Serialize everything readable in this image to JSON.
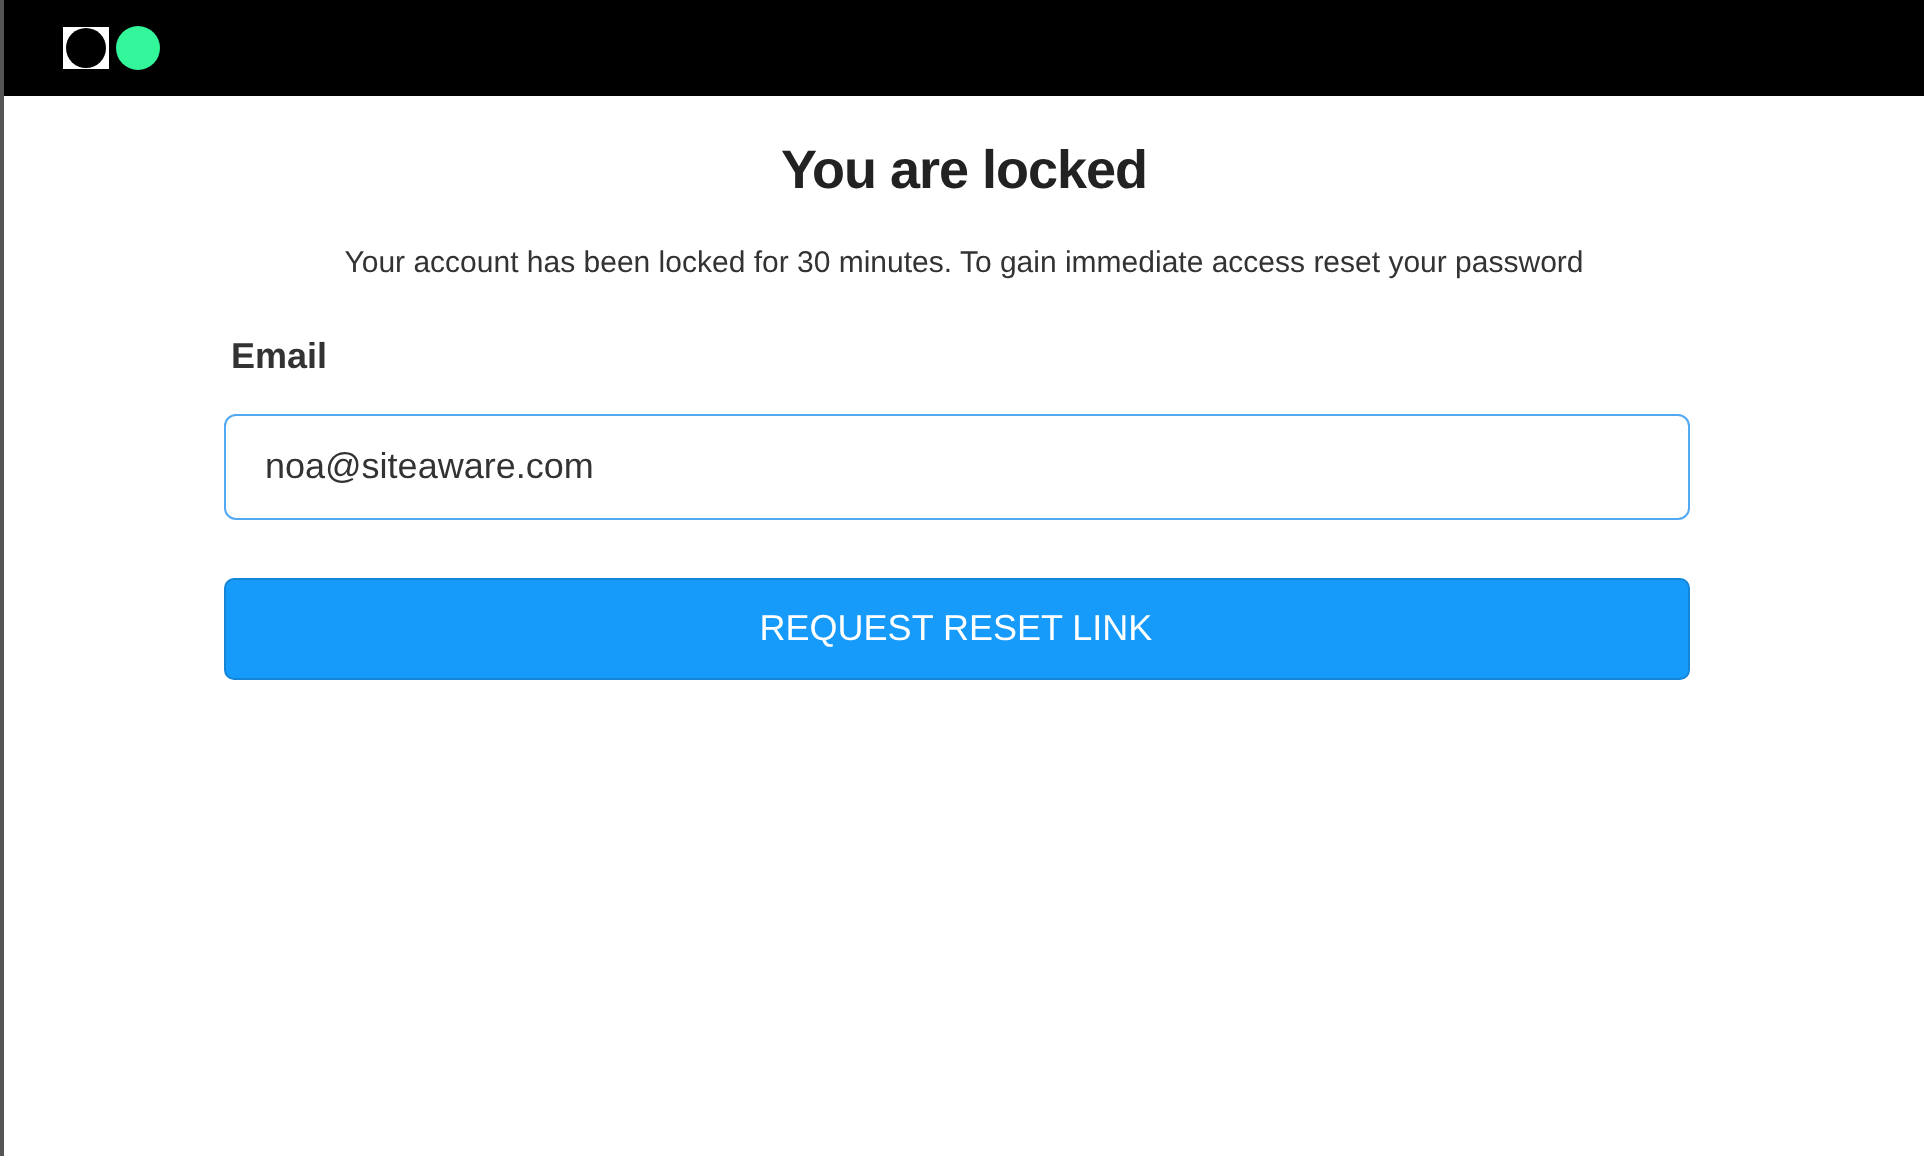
{
  "header": {
    "logo": true
  },
  "title": "You are locked",
  "message": "Your account has been locked for 30 minutes. To gain immediate access reset your password",
  "form": {
    "label": "Email",
    "value": "noa@siteaware.com",
    "button": "REQUEST RESET LINK"
  }
}
